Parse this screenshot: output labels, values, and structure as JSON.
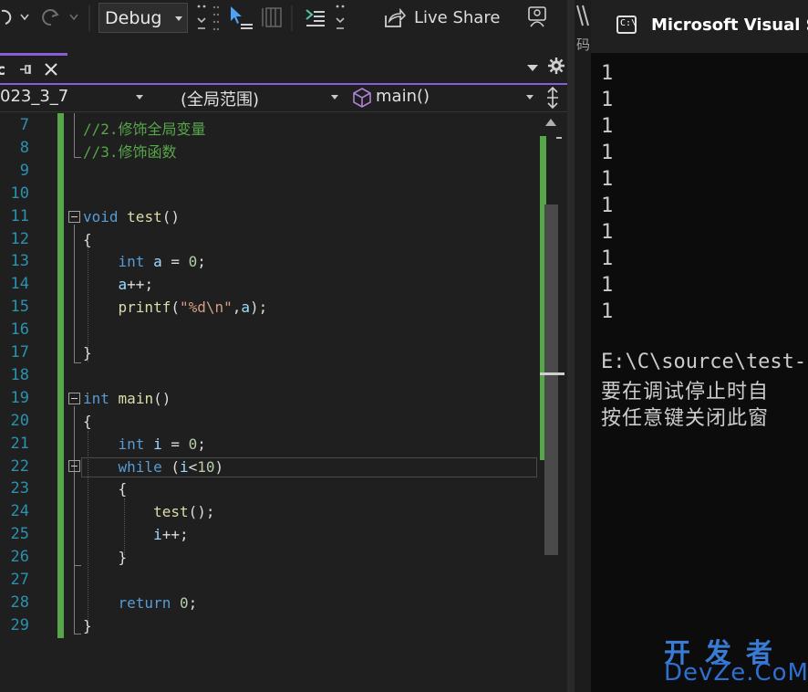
{
  "toolbar": {
    "configuration": "Debug",
    "live_share_label": "Live Share"
  },
  "tabs": {
    "pin_glyph": "⊸",
    "close_glyph": "✕"
  },
  "navbar": {
    "project": "023_3_7",
    "scope": "(全局范围)",
    "member": "main()"
  },
  "editor": {
    "lines": [
      {
        "n": "7",
        "tokens": [
          [
            "cm",
            "//2.修饰全局变量"
          ]
        ]
      },
      {
        "n": "8",
        "tokens": [
          [
            "cm",
            "//3.修饰函数"
          ]
        ]
      },
      {
        "n": "9",
        "tokens": []
      },
      {
        "n": "10",
        "tokens": []
      },
      {
        "n": "11",
        "tokens": [
          [
            "kw",
            "void"
          ],
          [
            "pl",
            " "
          ],
          [
            "fn",
            "test"
          ],
          [
            "pl",
            "()"
          ]
        ]
      },
      {
        "n": "12",
        "tokens": [
          [
            "pl",
            "{"
          ]
        ]
      },
      {
        "n": "13",
        "tokens": [
          [
            "pl",
            "    "
          ],
          [
            "kw",
            "int"
          ],
          [
            "pl",
            " "
          ],
          [
            "var",
            "a"
          ],
          [
            "pl",
            " = "
          ],
          [
            "num",
            "0"
          ],
          [
            "pl",
            ";"
          ]
        ]
      },
      {
        "n": "14",
        "tokens": [
          [
            "pl",
            "    "
          ],
          [
            "var",
            "a"
          ],
          [
            "pl",
            "++;"
          ]
        ]
      },
      {
        "n": "15",
        "tokens": [
          [
            "pl",
            "    "
          ],
          [
            "fn",
            "printf"
          ],
          [
            "pl",
            "("
          ],
          [
            "str",
            "\"%d\\n\""
          ],
          [
            "pl",
            ","
          ],
          [
            "var",
            "a"
          ],
          [
            "pl",
            ");"
          ]
        ]
      },
      {
        "n": "16",
        "tokens": []
      },
      {
        "n": "17",
        "tokens": [
          [
            "pl",
            "}"
          ]
        ]
      },
      {
        "n": "18",
        "tokens": []
      },
      {
        "n": "19",
        "tokens": [
          [
            "kw",
            "int"
          ],
          [
            "pl",
            " "
          ],
          [
            "fn",
            "main"
          ],
          [
            "pl",
            "()"
          ]
        ]
      },
      {
        "n": "20",
        "tokens": [
          [
            "pl",
            "{"
          ]
        ]
      },
      {
        "n": "21",
        "tokens": [
          [
            "pl",
            "    "
          ],
          [
            "kw",
            "int"
          ],
          [
            "pl",
            " "
          ],
          [
            "var",
            "i"
          ],
          [
            "pl",
            " = "
          ],
          [
            "num",
            "0"
          ],
          [
            "pl",
            ";"
          ]
        ]
      },
      {
        "n": "22",
        "tokens": [
          [
            "pl",
            "    "
          ],
          [
            "kw",
            "while"
          ],
          [
            "pl",
            " ("
          ],
          [
            "var",
            "i"
          ],
          [
            "pl",
            "<"
          ],
          [
            "num",
            "10"
          ],
          [
            "pl",
            ")"
          ]
        ]
      },
      {
        "n": "23",
        "tokens": [
          [
            "pl",
            "    {"
          ]
        ]
      },
      {
        "n": "24",
        "tokens": [
          [
            "pl",
            "        "
          ],
          [
            "fn",
            "test"
          ],
          [
            "pl",
            "();"
          ]
        ]
      },
      {
        "n": "25",
        "tokens": [
          [
            "pl",
            "        "
          ],
          [
            "var",
            "i"
          ],
          [
            "pl",
            "++;"
          ]
        ]
      },
      {
        "n": "26",
        "tokens": [
          [
            "pl",
            "    }"
          ]
        ]
      },
      {
        "n": "27",
        "tokens": []
      },
      {
        "n": "28",
        "tokens": [
          [
            "pl",
            "    "
          ],
          [
            "kw",
            "return"
          ],
          [
            "pl",
            " "
          ],
          [
            "num",
            "0"
          ],
          [
            "pl",
            ";"
          ]
        ]
      },
      {
        "n": "29",
        "tokens": [
          [
            "pl",
            "}"
          ]
        ]
      }
    ]
  },
  "console": {
    "edge_text": "码",
    "title": "Microsoft Visual Studio",
    "icon_glyph": "C:\\",
    "output": [
      "1",
      "1",
      "1",
      "1",
      "1",
      "1",
      "1",
      "1",
      "1",
      "1"
    ],
    "path_line": "E:\\C\\source\\test-",
    "msg_line1": "要在调试停止时自",
    "msg_line2": "按任意键关闭此窗"
  },
  "watermark": {
    "top": "开发者",
    "bottom": "DevZe.CoM"
  },
  "colors": {
    "accent": "#8a5cd6",
    "change_bar": "#57a64a",
    "keyword": "#569cd6",
    "function": "#dcdcaa",
    "variable": "#9cdcfe",
    "number": "#b5cea8",
    "string": "#d69d85",
    "comment": "#57a64a",
    "line_number": "#2b91af"
  },
  "icons": [
    "undo-icon",
    "redo-icon",
    "step-icon",
    "cursor-icon",
    "indent-icon",
    "live-share-icon",
    "feedback-icon",
    "pin-icon",
    "close-icon",
    "gear-icon",
    "dropdown-arrow-icon",
    "split-icon",
    "cube-icon",
    "console-icon"
  ]
}
